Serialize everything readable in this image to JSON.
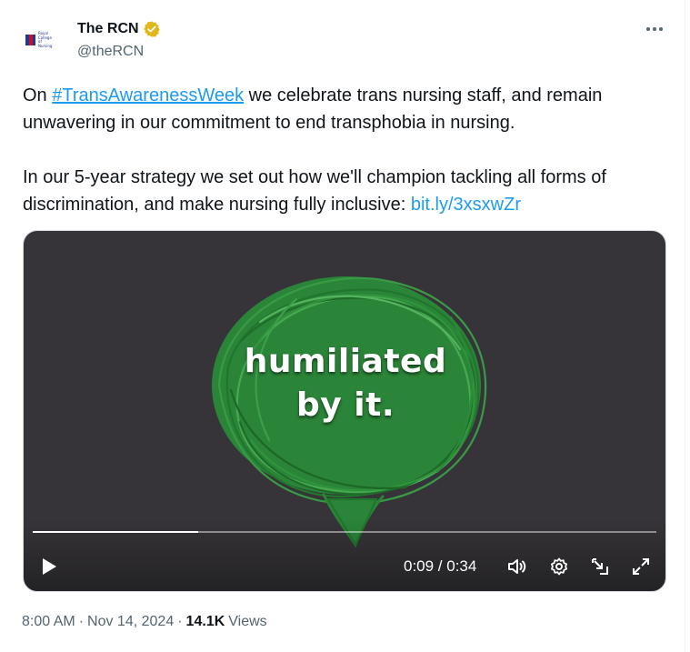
{
  "author": {
    "display_name": "The RCN",
    "handle": "@theRCN",
    "avatar_text": "Royal College of Nursing"
  },
  "tweet": {
    "prefix_1": "On ",
    "hashtag": "#TransAwarenessWeek",
    "suffix_1": " we celebrate trans nursing staff, and remain unwavering in our commitment to end transphobia in nursing.",
    "para_2": "In our 5-year strategy we set out how we'll champion tackling all forms of discrimination, and make nursing fully inclusive: ",
    "link": "bit.ly/3xsxwZr"
  },
  "media": {
    "caption_line_1": "humiliated",
    "caption_line_2": "by it.",
    "time_display": "0:09 / 0:34",
    "progress_fraction": 0.265,
    "bubble_color": "#2e8b3a",
    "background_color": "#363438"
  },
  "meta": {
    "time": "8:00 AM",
    "separator_1": "·",
    "date": "Nov 14, 2024",
    "separator_2": "·",
    "views_count": "14.1K",
    "views_label": "Views"
  },
  "colors": {
    "link": "#1d9bf0",
    "secondary_text": "#536471",
    "verified_badge": "#e2b719"
  }
}
